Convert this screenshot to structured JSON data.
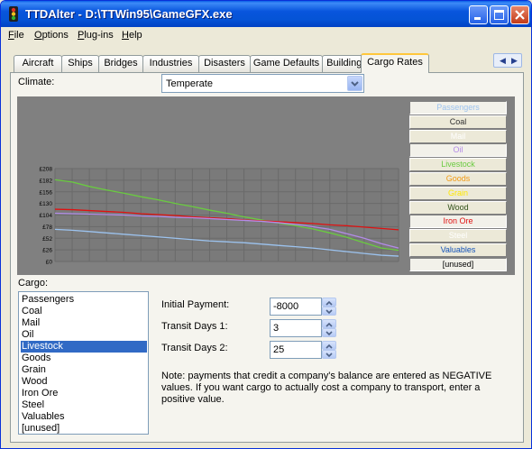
{
  "window": {
    "title": "TTDAlter - D:\\TTWin95\\GameGFX.exe"
  },
  "menu": [
    {
      "label": "File",
      "underline": "F",
      "rest": "ile"
    },
    {
      "label": "Options",
      "underline": "O",
      "rest": "ptions"
    },
    {
      "label": "Plug-ins",
      "underline": "P",
      "rest": "lug-ins"
    },
    {
      "label": "Help",
      "underline": "H",
      "rest": "elp"
    }
  ],
  "tabs": [
    "Aircraft",
    "Ships",
    "Bridges",
    "Industries",
    "Disasters",
    "Game Defaults",
    "Buildings",
    "Cargo Rates"
  ],
  "active_tab": "Cargo Rates",
  "climate": {
    "label": "Climate:",
    "value": "Temperate"
  },
  "legend": [
    {
      "label": "Passengers",
      "color": "#9CC3EF",
      "pressed": true
    },
    {
      "label": "Coal",
      "color": "#303030",
      "pressed": false
    },
    {
      "label": "Mail",
      "color": "#FFFFFF",
      "pressed": false
    },
    {
      "label": "Oil",
      "color": "#B38BE8",
      "pressed": true
    },
    {
      "label": "Livestock",
      "color": "#6ACB40",
      "pressed": false
    },
    {
      "label": "Goods",
      "color": "#F29A14",
      "pressed": false
    },
    {
      "label": "Grain",
      "color": "#FFE800",
      "pressed": false
    },
    {
      "label": "Wood",
      "color": "#305018",
      "pressed": false
    },
    {
      "label": "Iron Ore",
      "color": "#E01010",
      "pressed": true
    },
    {
      "label": "Steel",
      "color": "#FFFFFF",
      "pressed": false
    },
    {
      "label": "Valuables",
      "color": "#1050B8",
      "pressed": false
    },
    {
      "label": "[unused]",
      "color": "#000000",
      "pressed": true
    }
  ],
  "chart_data": {
    "type": "line",
    "title": "",
    "xlabel": "",
    "ylabel": "",
    "yticks": [
      "£208",
      "£182",
      "£156",
      "£130",
      "£104",
      "£78",
      "£52",
      "£26",
      "£0"
    ],
    "ylim": [
      0,
      208
    ],
    "x": [
      0,
      1,
      2,
      3,
      4,
      5,
      6,
      7,
      8,
      9,
      10,
      11,
      12,
      13,
      14,
      15,
      16,
      17,
      18,
      19,
      20
    ],
    "grid": true,
    "series": [
      {
        "name": "Livestock",
        "color": "#6ACB40",
        "values": [
          183,
          178,
          168,
          160,
          153,
          145,
          138,
          130,
          123,
          115,
          108,
          100,
          93,
          86,
          80,
          73,
          64,
          54,
          42,
          30,
          25
        ]
      },
      {
        "name": "Iron Ore",
        "color": "#E01010",
        "values": [
          117,
          116,
          114,
          112,
          110,
          107,
          105,
          103,
          100,
          98,
          96,
          93,
          91,
          89,
          87,
          85,
          82,
          80,
          77,
          74,
          71
        ]
      },
      {
        "name": "Oil",
        "color": "#B38BE8",
        "values": [
          108,
          107,
          106,
          105,
          104,
          102,
          101,
          99,
          98,
          96,
          94,
          92,
          90,
          87,
          83,
          78,
          72,
          62,
          52,
          40,
          30
        ]
      },
      {
        "name": "Passengers",
        "color": "#9CC3EF",
        "values": [
          72,
          70,
          67,
          64,
          61,
          58,
          55,
          52,
          49,
          46,
          44,
          42,
          39,
          36,
          33,
          30,
          26,
          22,
          18,
          14,
          12
        ]
      }
    ]
  },
  "cargo": {
    "label": "Cargo:",
    "items": [
      "Passengers",
      "Coal",
      "Mail",
      "Oil",
      "Livestock",
      "Goods",
      "Grain",
      "Wood",
      "Iron Ore",
      "Steel",
      "Valuables",
      "[unused]"
    ],
    "selected": "Livestock"
  },
  "fields": {
    "initial_payment": {
      "label": "Initial Payment:",
      "value": "-8000"
    },
    "transit_days_1": {
      "label": "Transit Days 1:",
      "value": "3"
    },
    "transit_days_2": {
      "label": "Transit Days 2:",
      "value": "25"
    }
  },
  "note": "Note: payments that credit a company's balance are entered as NEGATIVE values. If you want cargo to actually cost a company to transport, enter a positive value."
}
